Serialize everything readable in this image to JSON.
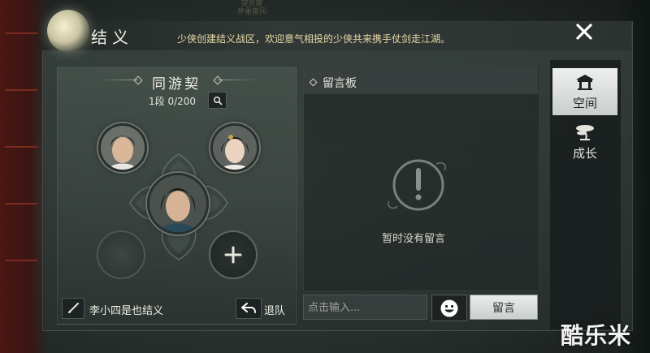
{
  "background": {
    "top_sign": [
      "突厉崖",
      "·斧重崖风·"
    ]
  },
  "header": {
    "title": "结义",
    "notice": "少侠创建结义战区，欢迎意气相投的少侠共来携手仗剑走江湖。",
    "close_icon": "close-icon"
  },
  "pact": {
    "title": "同游契",
    "level": "1段 0/200",
    "search_icon": "search-icon",
    "slots": [
      {
        "type": "avatar",
        "desc": "male-portrait"
      },
      {
        "type": "avatar",
        "desc": "female-portrait"
      },
      {
        "type": "avatar",
        "desc": "main-male-portrait"
      },
      {
        "type": "empty"
      },
      {
        "type": "add",
        "symbol": "+"
      }
    ],
    "member_text": "李小四是也结义",
    "leave_label": "退队"
  },
  "board": {
    "title": "留言板",
    "empty_text": "暂时没有留言",
    "input_placeholder": "点击输入...",
    "post_label": "留言"
  },
  "tabs": [
    {
      "label": "空间",
      "icon": "pavilion-icon",
      "active": true
    },
    {
      "label": "成长",
      "icon": "bonsai-tree-icon",
      "active": false
    }
  ],
  "watermark": "酷乐米",
  "colors": {
    "notice": "#e9d9a8",
    "active_tab": "#eef0ee",
    "panel": "#3c4642"
  }
}
